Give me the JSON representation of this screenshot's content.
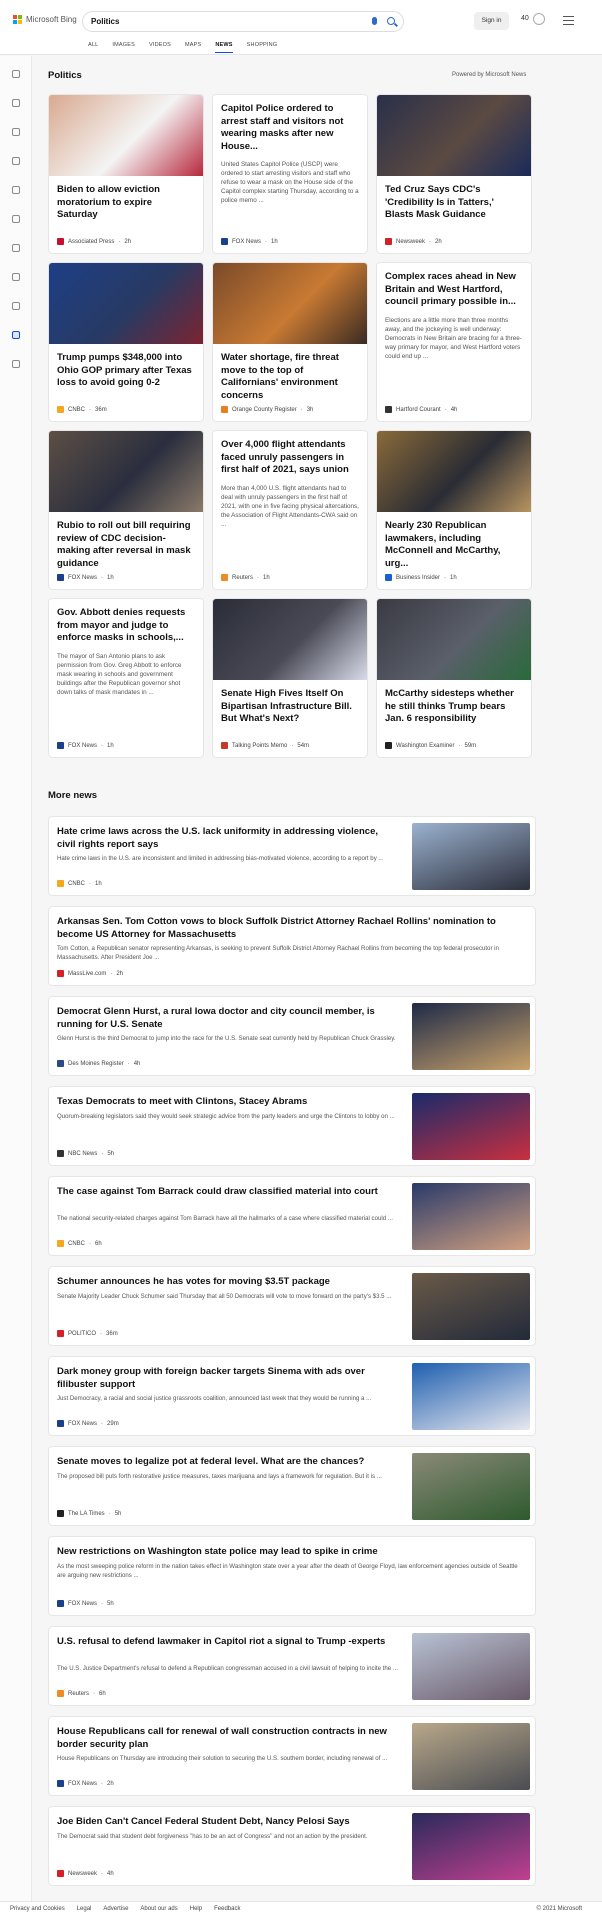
{
  "header": {
    "logo_text": "Microsoft Bing",
    "search_value": "Politics",
    "signin_label": "Sign in",
    "points": "40"
  },
  "nav": {
    "tabs": [
      "ALL",
      "IMAGES",
      "VIDEOS",
      "MAPS",
      "NEWS",
      "SHOPPING"
    ],
    "active": "NEWS"
  },
  "sidebar": {
    "icons": [
      "expand-icon",
      "home-icon",
      "sports-icon",
      "flag-icon",
      "pin-icon",
      "globe-icon",
      "science-icon",
      "rocket-icon",
      "video-icon",
      "politics-icon",
      "money-icon"
    ]
  },
  "main": {
    "title": "Politics",
    "powered_by": "Powered by Microsoft News",
    "more_title": "More news"
  },
  "cards": [
    {
      "title": "Biden to allow eviction moratorium to expire Saturday",
      "desc": "",
      "source": "Associated Press",
      "time": "2h",
      "fav": "#c8102e",
      "img": [
        "#d9a98f",
        "#f4f4f4",
        "#b6283c"
      ]
    },
    {
      "title": "Capitol Police ordered to arrest staff and visitors not wearing masks after new House...",
      "desc": "United States Capitol Police (USCP) were ordered to start arresting visitors and staff who refuse to wear a mask on the House side of the Capitol complex starting Thursday, according to a police memo ...",
      "source": "FOX News",
      "time": "1h",
      "fav": "#1a3f8c",
      "img": null
    },
    {
      "title": "Ted Cruz Says CDC's 'Credibility Is in Tatters,' Blasts Mask Guidance",
      "desc": "",
      "source": "Newsweek",
      "time": "2h",
      "fav": "#d42027",
      "img": [
        "#2a2f4a",
        "#5b4a42",
        "#1a2a5a"
      ]
    },
    {
      "title": "Trump pumps $348,000 into Ohio GOP primary after Texas loss to avoid going 0-2",
      "desc": "",
      "source": "CNBC",
      "time": "36m",
      "fav": "#f5a623",
      "img": [
        "#1d3f86",
        "#283a63",
        "#7c2430"
      ]
    },
    {
      "title": "Water shortage, fire threat move to the top of Californians' environment concerns",
      "desc": "",
      "source": "Orange County Register",
      "time": "3h",
      "fav": "#e87f23",
      "img": [
        "#7a4a2a",
        "#c87a33",
        "#3a2a22"
      ]
    },
    {
      "title": "Complex races ahead in New Britain and West Hartford, council primary possible in...",
      "desc": "Elections are a little more than three months away, and the jockeying is well underway: Democrats in New Britain are bracing for a three-way primary for mayor, and West Hartford voters could end up ...",
      "source": "Hartford Courant",
      "time": "4h",
      "fav": "#333333",
      "img": null
    },
    {
      "title": "Rubio to roll out bill requiring review of CDC decision-making after reversal in mask guidance",
      "desc": "",
      "source": "FOX News",
      "time": "1h",
      "fav": "#1a3f8c",
      "img": [
        "#5c4f45",
        "#2a2e3e",
        "#8a7a68"
      ]
    },
    {
      "title": "Over 4,000 flight attendants faced unruly passengers in first half of 2021, says union",
      "desc": "More than 4,000 U.S. flight attendants had to deal with unruly passengers in the first half of 2021, with one in five facing physical altercations, the Association of Flight Attendants-CWA said on ...",
      "source": "Reuters",
      "time": "1h",
      "fav": "#f08a24",
      "img": null
    },
    {
      "title": "Nearly 230 Republican lawmakers, including McConnell and McCarthy, urg...",
      "desc": "",
      "source": "Business Insider",
      "time": "1h",
      "fav": "#1b5fd6",
      "img": [
        "#8a6a3a",
        "#2a2c34",
        "#b89560"
      ]
    },
    {
      "title": "Gov. Abbott denies requests from mayor and judge to enforce masks in schools,...",
      "desc": "The mayor of San Antonio plans to ask permission from Gov. Greg Abbott to enforce mask wearing in schools and government buildings after the Republican governor shot down talks of mask mandates in ...",
      "source": "FOX News",
      "time": "1h",
      "fav": "#1a3f8c",
      "img": null
    },
    {
      "title": "Senate High Fives Itself On Bipartisan Infrastructure Bill. But What's Next?",
      "desc": "",
      "source": "Talking Points Memo",
      "time": "54m",
      "fav": "#c8382a",
      "img": [
        "#2a2d38",
        "#4a4a56",
        "#d8dcea"
      ]
    },
    {
      "title": "McCarthy sidesteps whether he still thinks Trump bears Jan. 6 responsibility",
      "desc": "",
      "source": "Washington Examiner",
      "time": "59m",
      "fav": "#222222",
      "img": [
        "#3a3a42",
        "#5a5f6a",
        "#2a6a3a"
      ]
    }
  ],
  "more_news": [
    {
      "title": "Hate crime laws across the U.S. lack uniformity in addressing violence, civil rights report says",
      "desc": "Hate crime laws in the U.S. are inconsistent and limited in addressing bias-motivated violence, according to a report by ...",
      "source": "CNBC",
      "time": "1h",
      "fav": "#f5a623",
      "thumb": [
        "#9bb2cf",
        "#2c2f3c"
      ]
    },
    {
      "title": "Arkansas Sen. Tom Cotton vows to block Suffolk District Attorney Rachael Rollins' nomination to become US Attorney for Massachusetts",
      "desc": "Tom Cotton, a Republican senator representing Arkansas, is seeking to prevent Suffolk District Attorney Rachael Rollins from becoming the top federal prosecutor in Massachusetts. After President Joe ...",
      "source": "MassLive.com",
      "time": "2h",
      "fav": "#d42027",
      "thumb": null
    },
    {
      "title": "Democrat Glenn Hurst, a rural Iowa doctor and city council member, is running for U.S. Senate",
      "desc": "Glenn Hurst is the third Democrat to jump into the race for the U.S. Senate seat currently held by Republican Chuck Grassley.",
      "source": "Des Moines Register",
      "time": "4h",
      "fav": "#2a4a8a",
      "thumb": [
        "#1e2a48",
        "#c9a26a"
      ]
    },
    {
      "title": "Texas Democrats to meet with Clintons, Stacey Abrams",
      "desc": "Quorum-breaking legislators said they would seek strategic advice from the party leaders and urge the Clintons to lobby on ...",
      "source": "NBC News",
      "time": "5h",
      "fav": "#333333",
      "thumb": [
        "#1a2a6a",
        "#c83040"
      ]
    },
    {
      "title": "The case against Tom Barrack could draw classified material into court",
      "desc": "The national security-related charges against Tom Barrack have all the hallmarks of a case where classified material could ...",
      "source": "CNBC",
      "time": "6h",
      "fav": "#f5a623",
      "thumb": [
        "#2a3a6a",
        "#d0a080"
      ]
    },
    {
      "title": "Schumer announces he has votes for moving $3.5T package",
      "desc": "Senate Majority Leader Chuck Schumer said Thursday that all 50 Democrats will vote to move forward on the party's $3.5 ...",
      "source": "POLITICO",
      "time": "36m",
      "fav": "#d42027",
      "thumb": [
        "#6a5a48",
        "#222a3a"
      ]
    },
    {
      "title": "Dark money group with foreign backer targets Sinema with ads over filibuster support",
      "desc": "Just Democracy, a racial and social justice grassroots coalition, announced last week that they would be running a ...",
      "source": "FOX News",
      "time": "29m",
      "fav": "#1a3f8c",
      "thumb": [
        "#1f5fb0",
        "#e8e8ee"
      ]
    },
    {
      "title": "Senate moves to legalize pot at federal level. What are the chances?",
      "desc": "The proposed bill puts forth restorative justice measures, taxes marijuana and lays a framework for regulation. But it is ...",
      "source": "The LA Times",
      "time": "5h",
      "fav": "#222222",
      "thumb": [
        "#8a8a78",
        "#2e5a2e"
      ]
    },
    {
      "title": "New restrictions on Washington state police may lead to spike in crime",
      "desc": "As the most sweeping police reform in the nation takes effect in Washington state over a year after the death of George Floyd, law enforcement agencies outside of Seattle are arguing new restrictions ...",
      "source": "FOX News",
      "time": "5h",
      "fav": "#1a3f8c",
      "thumb": null
    },
    {
      "title": "U.S. refusal to defend lawmaker in Capitol riot a signal to Trump -experts",
      "desc": "The U.S. Justice Department's refusal to defend a Republican congressman accused in a civil lawsuit of helping to incite the ...",
      "source": "Reuters",
      "time": "6h",
      "fav": "#f08a24",
      "thumb": [
        "#b8c2d4",
        "#6a5a6a"
      ]
    },
    {
      "title": "House Republicans call for renewal of wall construction contracts in new border security plan",
      "desc": "House Republicans on Thursday are introducing their solution to securing the U.S. southern border, including renewal of ...",
      "source": "FOX News",
      "time": "2h",
      "fav": "#1a3f8c",
      "thumb": [
        "#b9a88a",
        "#4a4c52"
      ]
    },
    {
      "title": "Joe Biden Can't Cancel Federal Student Debt, Nancy Pelosi Says",
      "desc": "The Democrat said that student debt forgiveness \"has to be an act of Congress\" and not an action by the president.",
      "source": "Newsweek",
      "time": "4h",
      "fav": "#d42027",
      "thumb": [
        "#2a2a5a",
        "#c04090"
      ]
    }
  ],
  "footer": {
    "links": [
      "Privacy and Cookies",
      "Legal",
      "Advertise",
      "About our ads",
      "Help",
      "Feedback"
    ],
    "copyright": "© 2021 Microsoft"
  },
  "colors": {
    "accent": "#174ae4",
    "logo": [
      "#f25022",
      "#7fba00",
      "#00a4ef",
      "#ffb900"
    ]
  }
}
